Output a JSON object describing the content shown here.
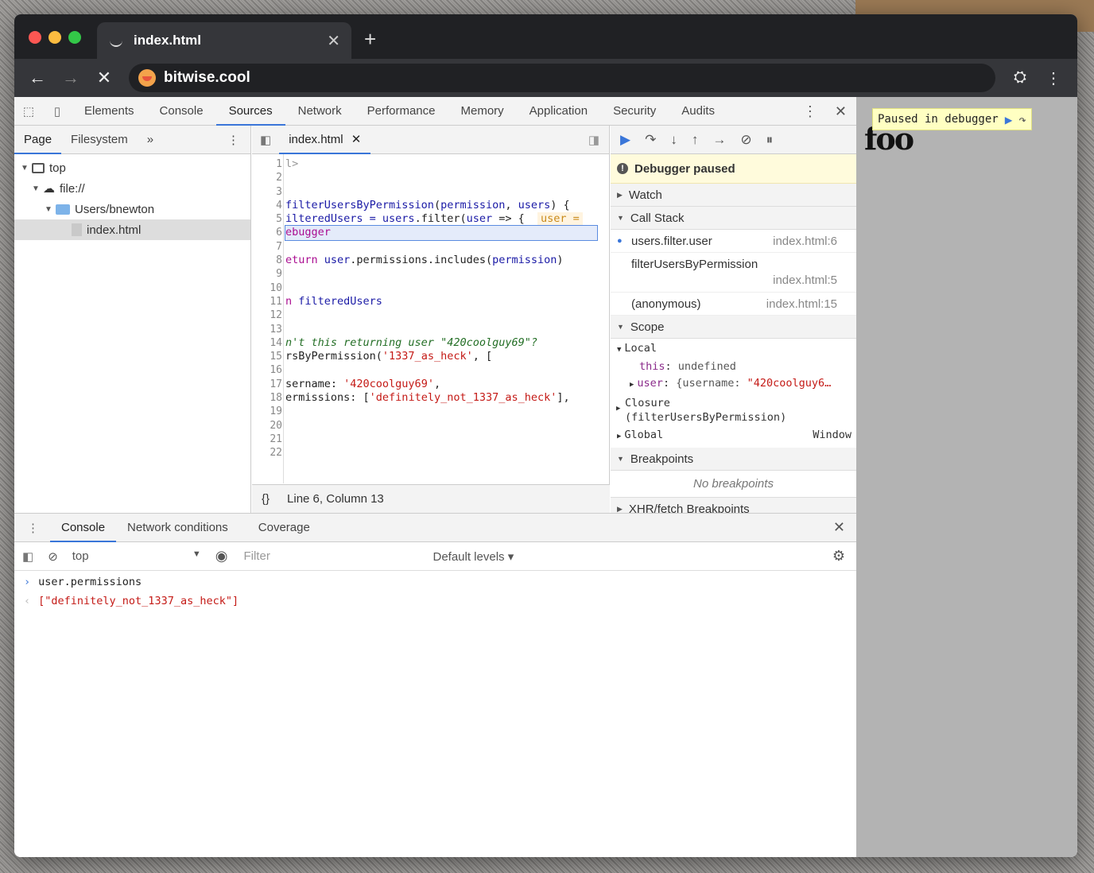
{
  "browser": {
    "tab_title": "index.html",
    "url": "bitwise.cool"
  },
  "viewport": {
    "paused_banner": "Paused in debugger",
    "page_text": "foo"
  },
  "devtools": {
    "panels": [
      "Elements",
      "Console",
      "Sources",
      "Network",
      "Performance",
      "Memory",
      "Application",
      "Security",
      "Audits"
    ],
    "active_panel": "Sources",
    "navigator": {
      "tabs": [
        "Page",
        "Filesystem"
      ],
      "more": "»",
      "tree": [
        "top",
        "file://",
        "Users/bnewton",
        "index.html"
      ]
    },
    "editor": {
      "file_tab": "index.html",
      "status": "Line 6, Column 13",
      "format_icon": "{}",
      "line_numbers": [
        "1",
        "2",
        "3",
        "4",
        "5",
        "6",
        "7",
        "8",
        "9",
        "10",
        "11",
        "12",
        "13",
        "14",
        "15",
        "16",
        "17",
        "18",
        "19",
        "20",
        "21",
        "22"
      ],
      "lines": {
        "l1": "l>",
        "l4a": "filterUsersByPermission",
        "l4b": "(",
        "l4c": "permission",
        "l4d": ", ",
        "l4e": "users",
        "l4f": ") {",
        "l5a": "ilteredUsers = ",
        "l5b": "users",
        "l5c": ".filter(",
        "l5d": "user",
        "l5e": " => {",
        "l5inline": "user =",
        "l6": "ebugger",
        "l8a": "eturn ",
        "l8b": "user",
        "l8c": ".permissions.includes(",
        "l8d": "permission",
        "l8e": ")",
        "l11a": "n ",
        "l11b": "filteredUsers",
        "l14": "n't this returning user \"420coolguy69\"?",
        "l15a": "rsByPermission(",
        "l15b": "'1337_as_heck'",
        "l15c": ", [",
        "l17a": "sername: ",
        "l17b": "'420coolguy69'",
        "l17c": ",",
        "l18a": "ermissions: [",
        "l18b": "'definitely_not_1337_as_heck'",
        "l18c": "],"
      }
    },
    "debugger": {
      "paused_message": "Debugger paused",
      "watch": "Watch",
      "call_stack_label": "Call Stack",
      "call_stack": [
        {
          "name": "users.filter.user",
          "loc": "index.html:6"
        },
        {
          "name": "filterUsersByPermission",
          "loc": "index.html:5"
        },
        {
          "name": "(anonymous)",
          "loc": "index.html:15"
        }
      ],
      "scope_label": "Scope",
      "local_label": "Local",
      "this_key": "this",
      "this_val": "undefined",
      "user_key": "user",
      "user_val_prefix": "{username: ",
      "user_val_str": "\"420coolguy6…",
      "closure_label": "Closure",
      "closure_detail": "(filterUsersByPermission)",
      "global_label": "Global",
      "global_val": "Window",
      "breakpoints_label": "Breakpoints",
      "no_breakpoints": "No breakpoints",
      "xhr_label": "XHR/fetch Breakpoints"
    },
    "drawer": {
      "tabs": [
        "Console",
        "Network conditions",
        "Coverage"
      ],
      "context": "top",
      "filter_placeholder": "Filter",
      "levels": "Default levels ▾",
      "input": "user.permissions",
      "output": "[\"definitely_not_1337_as_heck\"]"
    }
  }
}
